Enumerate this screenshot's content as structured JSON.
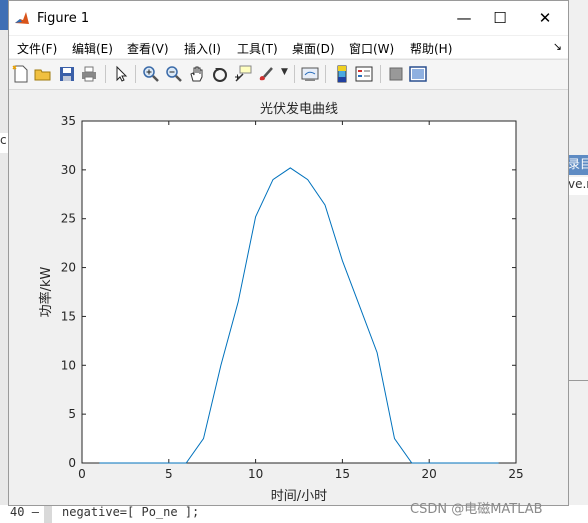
{
  "window": {
    "title": "Figure 1",
    "controls": {
      "minimize": "—",
      "maximize": "☐",
      "close": "✕"
    }
  },
  "menu": {
    "items": [
      "文件(F)",
      "编辑(E)",
      "查看(V)",
      "插入(I)",
      "工具(T)",
      "桌面(D)",
      "窗口(W)",
      "帮助(H)"
    ],
    "overflow_icon": "dock-arrow-icon"
  },
  "toolbar": {
    "icons": [
      "new-figure-icon",
      "open-file-icon",
      "save-icon",
      "print-icon",
      "edit-plot-arrow-icon",
      "zoom-in-icon",
      "zoom-out-icon",
      "pan-hand-icon",
      "rotate-3d-icon",
      "data-cursor-icon",
      "brush-icon",
      "link-plot-icon",
      "colorbar-icon",
      "legend-icon",
      "hide-plot-tools-icon",
      "show-plot-tools-icon"
    ]
  },
  "background": {
    "left_fragment": "c",
    "right_tab_label": "录目",
    "right_tab_text": "ve.n",
    "line_number": "40",
    "line_marker": "–",
    "code_line": "negative=[ Po_ne ];",
    "watermark": "CSDN @电磁MATLAB"
  },
  "chart_data": {
    "type": "line",
    "title": "光伏发电曲线",
    "xlabel": "时间/小时",
    "ylabel": "功率/kW",
    "xlim": [
      0,
      25
    ],
    "ylim": [
      0,
      35
    ],
    "xticks": [
      0,
      5,
      10,
      15,
      20,
      25
    ],
    "yticks": [
      0,
      5,
      10,
      15,
      20,
      25,
      30,
      35
    ],
    "grid": false,
    "line_color": "#0072bd",
    "x": [
      1,
      2,
      3,
      4,
      5,
      6,
      7,
      8,
      9,
      10,
      11,
      12,
      13,
      14,
      15,
      16,
      17,
      18,
      19,
      20,
      21,
      22,
      23,
      24
    ],
    "y": [
      0,
      0,
      0,
      0,
      0,
      0,
      2.5,
      10,
      16.5,
      25.2,
      29,
      30.2,
      29,
      26.4,
      20.7,
      16,
      11.3,
      2.5,
      0,
      0,
      0,
      0,
      0,
      0
    ]
  }
}
